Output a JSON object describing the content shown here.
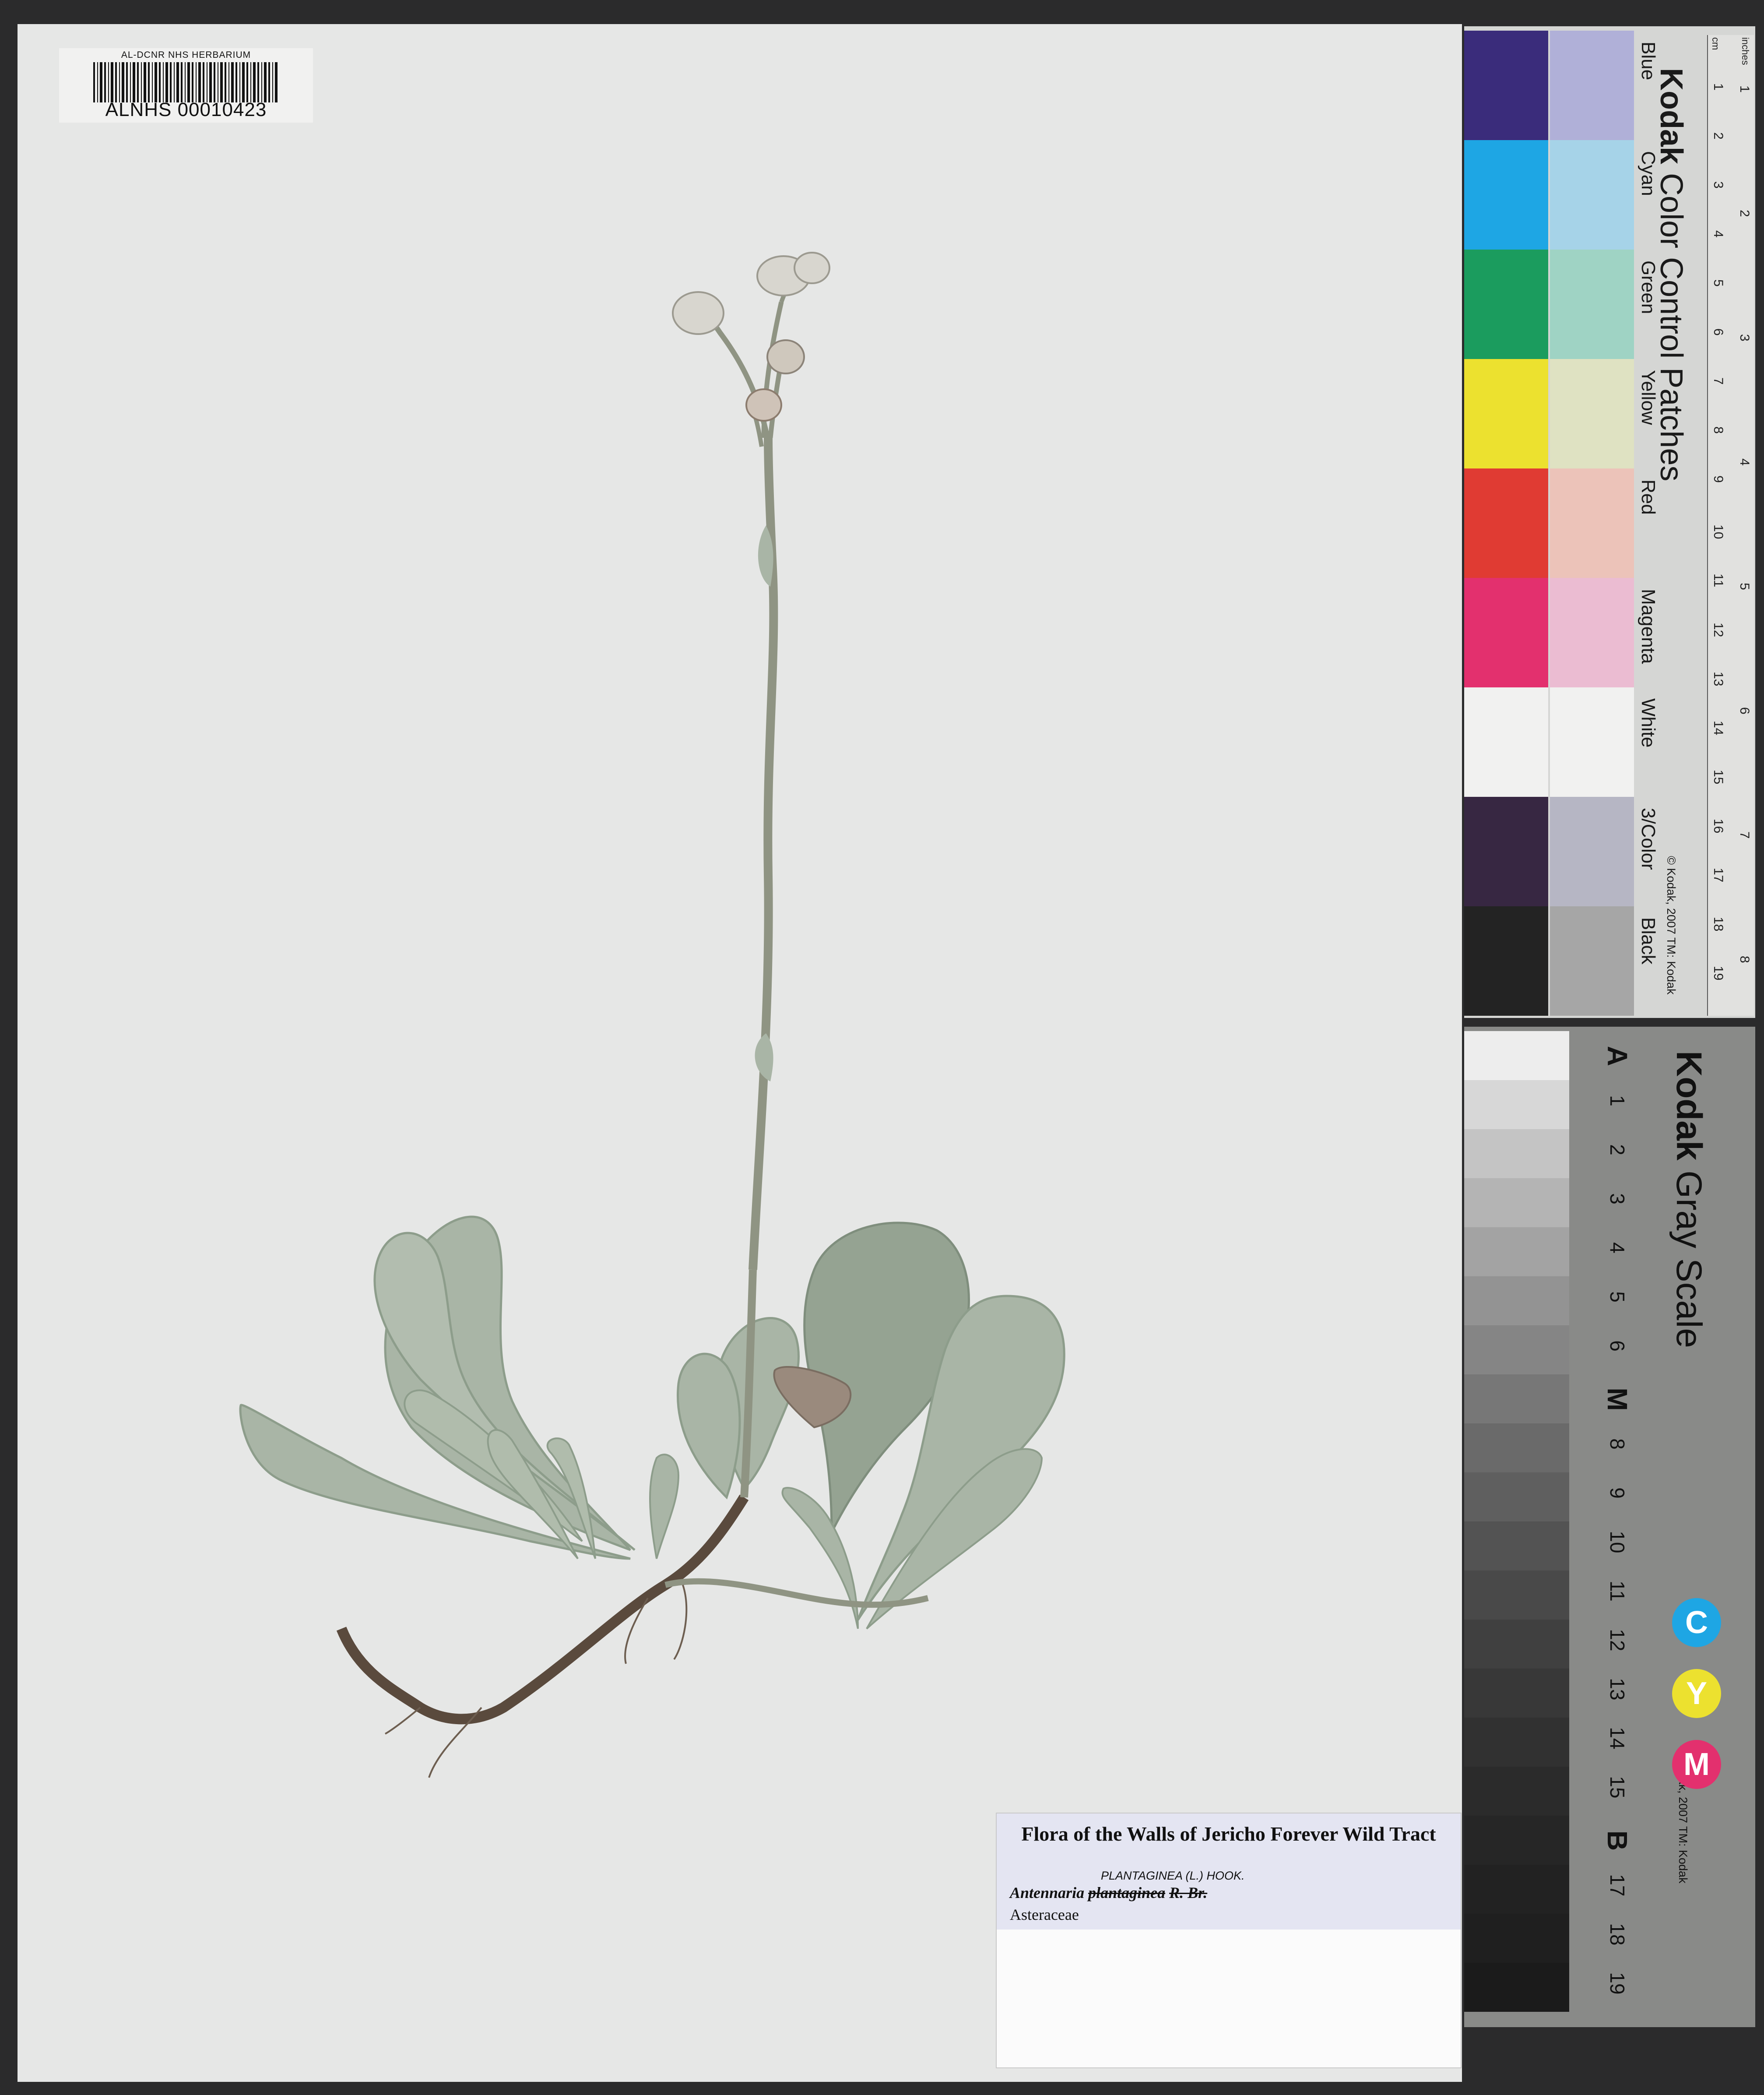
{
  "barcode_label": {
    "herbarium": "AL-DCNR NHS HERBARIUM",
    "catalog_number": "ALNHS 00010423"
  },
  "specimen_label": {
    "title": "Flora of the Walls of Jericho Forever Wild Tract",
    "genus": "Antennaria",
    "struck_epithet": "plantaginea",
    "struck_author": "R. Br.",
    "annotation": "PLANTAGINEA (L.) HOOK.",
    "family": "Asteraceae"
  },
  "color_card": {
    "brand": "Kodak",
    "title": "Color Control Patches",
    "copyright": "© Kodak, 2007 TM: Kodak",
    "patches": [
      {
        "name": "Blue",
        "dark": "#3a2c7b",
        "light": "#b0b0d8"
      },
      {
        "name": "Cyan",
        "dark": "#1ea6e4",
        "light": "#a6d3e8"
      },
      {
        "name": "Green",
        "dark": "#1b9c5e",
        "light": "#9fd3c4"
      },
      {
        "name": "Yellow",
        "dark": "#ece12f",
        "light": "#dfe2c2"
      },
      {
        "name": "Red",
        "dark": "#e03b33",
        "light": "#ecc3b9"
      },
      {
        "name": "Magenta",
        "dark": "#e3306e",
        "light": "#ebbcd2"
      },
      {
        "name": "White",
        "dark": "#f1f1f0",
        "light": "#f1f1f0"
      },
      {
        "name": "3/Color",
        "dark": "#372742",
        "light": "#b6b6c4"
      },
      {
        "name": "Black",
        "dark": "#232323",
        "light": "#a6a6a6"
      }
    ]
  },
  "ruler": {
    "cm_unit": "cm",
    "inch_unit": "inches",
    "cm_marks": [
      "1",
      "2",
      "3",
      "4",
      "5",
      "6",
      "7",
      "8",
      "9",
      "10",
      "11",
      "12",
      "13",
      "14",
      "15",
      "16",
      "17",
      "18",
      "19"
    ],
    "inch_marks": [
      "1",
      "2",
      "3",
      "4",
      "5",
      "6",
      "7",
      "8"
    ]
  },
  "gray_scale": {
    "brand": "Kodak",
    "title": "Gray Scale",
    "copyright": "© Kodak, 2007 TM: Kodak",
    "steps": [
      "A",
      "1",
      "2",
      "3",
      "4",
      "5",
      "6",
      "M",
      "8",
      "9",
      "10",
      "11",
      "12",
      "13",
      "14",
      "15",
      "B",
      "17",
      "18",
      "19"
    ],
    "step_colors": [
      "#ededed",
      "#d7d7d7",
      "#c4c4c4",
      "#b4b4b4",
      "#a3a3a3",
      "#939393",
      "#858585",
      "#777777",
      "#6a6a6a",
      "#5f5f5f",
      "#535353",
      "#494949",
      "#404040",
      "#383838",
      "#313131",
      "#2b2b2b",
      "#262626",
      "#222222",
      "#1f1f1f",
      "#1b1b1b"
    ],
    "cym": [
      {
        "letter": "C",
        "color": "#1ea6e4",
        "text": "#ffffff"
      },
      {
        "letter": "Y",
        "color": "#ece12f",
        "text": "#ffffff"
      },
      {
        "letter": "M",
        "color": "#e3306e",
        "text": "#ffffff"
      }
    ]
  },
  "colors": {
    "leaf": "#a9b5a6",
    "leaf_dark": "#8d9d8b",
    "stem": "#8f9483",
    "root": "#5a4a3d",
    "flower": "#d8d6cf"
  }
}
